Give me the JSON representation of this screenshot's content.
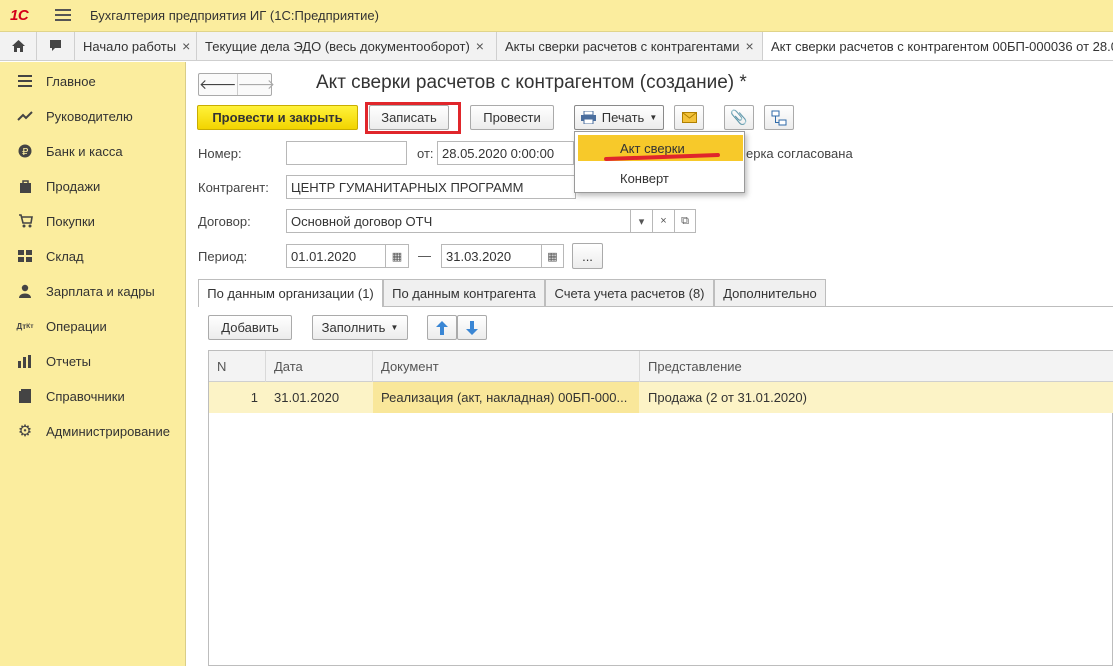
{
  "app": {
    "logo": "1С",
    "title": "Бухгалтерия предприятия ИГ  (1С:Предприятие)"
  },
  "tabs": [
    {
      "label": "Начало работы"
    },
    {
      "label": "Текущие дела ЭДО (весь документооборот)"
    },
    {
      "label": "Акты сверки расчетов с контрагентами"
    },
    {
      "label": "Акт сверки расчетов с контрагентом 00БП-000036 от 28.0"
    }
  ],
  "sidebar": {
    "items": [
      {
        "label": "Главное",
        "icon": "list-icon"
      },
      {
        "label": "Руководителю",
        "icon": "trend-icon"
      },
      {
        "label": "Банк и касса",
        "icon": "ruble-icon"
      },
      {
        "label": "Продажи",
        "icon": "bag-icon"
      },
      {
        "label": "Покупки",
        "icon": "cart-icon"
      },
      {
        "label": "Склад",
        "icon": "warehouse-icon"
      },
      {
        "label": "Зарплата и кадры",
        "icon": "person-icon"
      },
      {
        "label": "Операции",
        "icon": "dt-kt-icon"
      },
      {
        "label": "Отчеты",
        "icon": "bar-chart-icon"
      },
      {
        "label": "Справочники",
        "icon": "book-icon"
      },
      {
        "label": "Администрирование",
        "icon": "gear-icon"
      }
    ]
  },
  "form": {
    "title": "Акт сверки расчетов с контрагентом (создание) *",
    "toolbar": {
      "post_close": "Провести и закрыть",
      "save": "Записать",
      "post": "Провести",
      "print": "Печать"
    },
    "print_menu": {
      "items": [
        "Акт сверки",
        "Конверт"
      ]
    },
    "number_label": "Номер:",
    "number_value": "",
    "date_label": "от:",
    "date_value": "28.05.2020  0:00:00",
    "agreed_text": "ерка согласована",
    "counterparty_label": "Контрагент:",
    "counterparty_value": "ЦЕНТР ГУМАНИТАРНЫХ ПРОГРАММ",
    "contract_label": "Договор:",
    "contract_value": "Основной договор ОТЧ",
    "period_label": "Период:",
    "period_from": "01.01.2020",
    "period_dash": "—",
    "period_to": "31.03.2020",
    "more": "...",
    "page_tabs": [
      "По данным организации (1)",
      "По данным контрагента",
      "Счета учета расчетов (8)",
      "Дополнительно"
    ],
    "table_toolbar": {
      "add": "Добавить",
      "fill": "Заполнить"
    },
    "table": {
      "columns": [
        "N",
        "Дата",
        "Документ",
        "Представление"
      ],
      "rows": [
        {
          "n": "1",
          "date": "31.01.2020",
          "document": "Реализация (акт, накладная) 00БП-000...",
          "repr": "Продажа (2 от 31.01.2020)"
        }
      ]
    }
  },
  "colors": {
    "accent": "#fbed9e",
    "primary_button": "#f2d400",
    "highlight": "#e0262b",
    "selected_row": "#fcf3c6"
  }
}
